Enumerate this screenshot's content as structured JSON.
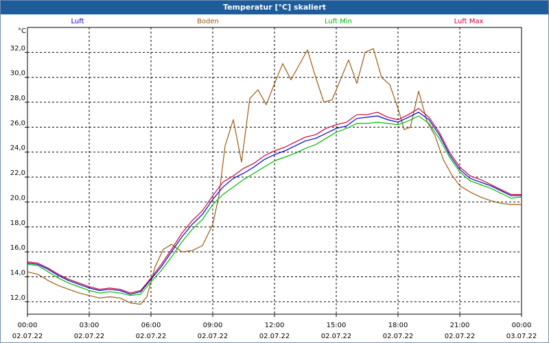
{
  "chart_data": {
    "type": "line",
    "title": "Temperatur [°C] skaliert",
    "ylabel": "°C",
    "ylim": [
      11.0,
      34.0
    ],
    "y_ticks": [
      "12,0",
      "14,0",
      "16,0",
      "18,0",
      "20,0",
      "22,0",
      "24,0",
      "26,0",
      "28,0",
      "30,0",
      "32,0"
    ],
    "x_ticks": [
      {
        "time": "00:00",
        "date": "02.07.22"
      },
      {
        "time": "03:00",
        "date": "02.07.22"
      },
      {
        "time": "06:00",
        "date": "02.07.22"
      },
      {
        "time": "09:00",
        "date": "02.07.22"
      },
      {
        "time": "12:00",
        "date": "02.07.22"
      },
      {
        "time": "15:00",
        "date": "02.07.22"
      },
      {
        "time": "18:00",
        "date": "02.07.22"
      },
      {
        "time": "21:00",
        "date": "02.07.22"
      },
      {
        "time": "00:00",
        "date": "03.07.22"
      }
    ],
    "x_unit": "hours since 02.07.22 00:00",
    "grid": true,
    "legend_position": "top",
    "series": [
      {
        "name": "Luft",
        "color": "#0000cc",
        "x": [
          0,
          0.5,
          1,
          1.5,
          2,
          2.5,
          3,
          3.5,
          4,
          4.5,
          5,
          5.5,
          6,
          6.5,
          7,
          7.5,
          8,
          8.5,
          9,
          9.5,
          10,
          10.5,
          11,
          11.5,
          12,
          12.5,
          13,
          13.5,
          14,
          14.5,
          15,
          15.5,
          16,
          16.5,
          17,
          17.5,
          18,
          18.5,
          19,
          19.5,
          20,
          20.5,
          21,
          21.5,
          22,
          22.5,
          23,
          23.5,
          24
        ],
        "y": [
          15.1,
          15.0,
          14.6,
          14.1,
          13.7,
          13.4,
          13.1,
          12.9,
          13.0,
          12.9,
          12.6,
          12.8,
          13.8,
          14.8,
          16.0,
          17.2,
          18.2,
          19.0,
          20.2,
          21.2,
          21.9,
          22.3,
          22.8,
          23.4,
          23.8,
          24.1,
          24.5,
          24.9,
          25.1,
          25.5,
          25.9,
          26.1,
          26.7,
          26.8,
          26.9,
          26.6,
          26.4,
          26.8,
          27.2,
          26.6,
          25.4,
          23.8,
          22.6,
          21.9,
          21.6,
          21.3,
          20.9,
          20.5,
          20.5
        ]
      },
      {
        "name": "Boden",
        "color": "#9c5a10",
        "x": [
          0,
          0.5,
          1,
          1.5,
          2,
          2.5,
          3,
          3.5,
          4,
          4.5,
          5,
          5.5,
          5.8,
          6.2,
          6.6,
          7,
          7.5,
          8,
          8.5,
          9,
          9.3,
          9.6,
          10,
          10.4,
          10.8,
          11.2,
          11.6,
          12,
          12.4,
          12.8,
          13.2,
          13.6,
          14,
          14.4,
          14.8,
          15.2,
          15.6,
          16,
          16.4,
          16.8,
          17.2,
          17.6,
          18,
          18.3,
          18.6,
          19,
          19.4,
          19.8,
          20.2,
          20.6,
          21,
          21.5,
          22,
          22.5,
          23,
          23.5,
          24
        ],
        "y": [
          14.4,
          14.2,
          13.7,
          13.3,
          13.0,
          12.7,
          12.5,
          12.3,
          12.4,
          12.3,
          11.9,
          11.8,
          12.4,
          14.8,
          16.2,
          16.6,
          16.0,
          16.1,
          16.5,
          18.2,
          20.5,
          24.5,
          26.6,
          23.2,
          28.3,
          29.0,
          27.8,
          29.5,
          31.1,
          29.8,
          31.0,
          32.2,
          30.0,
          28.0,
          28.2,
          29.8,
          31.4,
          29.5,
          32.0,
          32.3,
          30.0,
          29.4,
          27.5,
          25.8,
          26.0,
          28.9,
          26.5,
          25.3,
          23.4,
          22.2,
          21.3,
          20.8,
          20.4,
          20.1,
          19.9,
          19.8,
          19.8
        ]
      },
      {
        "name": "Luft Min",
        "color": "#00bb00",
        "x": [
          0,
          0.5,
          1,
          1.5,
          2,
          2.5,
          3,
          3.5,
          4,
          4.5,
          5,
          5.5,
          6,
          6.5,
          7,
          7.5,
          8,
          8.5,
          9,
          9.5,
          10,
          10.5,
          11,
          11.5,
          12,
          12.5,
          13,
          13.5,
          14,
          14.5,
          15,
          15.5,
          16,
          16.5,
          17,
          17.5,
          18,
          18.5,
          19,
          19.5,
          20,
          20.5,
          21,
          21.5,
          22,
          22.5,
          23,
          23.5,
          24
        ],
        "y": [
          15.0,
          14.9,
          14.4,
          13.9,
          13.5,
          13.2,
          12.9,
          12.7,
          12.8,
          12.7,
          12.5,
          12.6,
          13.6,
          14.5,
          15.6,
          16.8,
          17.8,
          18.6,
          19.8,
          20.6,
          21.2,
          21.8,
          22.3,
          22.8,
          23.3,
          23.6,
          23.9,
          24.3,
          24.6,
          25.1,
          25.6,
          25.9,
          26.3,
          26.3,
          26.4,
          26.3,
          26.2,
          26.5,
          26.9,
          26.3,
          25.1,
          23.6,
          22.4,
          21.7,
          21.4,
          21.1,
          20.7,
          20.3,
          20.4
        ]
      },
      {
        "name": "Luft Max",
        "color": "#cc0033",
        "x": [
          0,
          0.5,
          1,
          1.5,
          2,
          2.5,
          3,
          3.5,
          4,
          4.5,
          5,
          5.5,
          6,
          6.5,
          7,
          7.5,
          8,
          8.5,
          9,
          9.5,
          10,
          10.5,
          11,
          11.5,
          12,
          12.5,
          13,
          13.5,
          14,
          14.5,
          15,
          15.5,
          16,
          16.5,
          17,
          17.5,
          18,
          18.5,
          19,
          19.5,
          20,
          20.5,
          21,
          21.5,
          22,
          22.5,
          23,
          23.5,
          24
        ],
        "y": [
          15.2,
          15.1,
          14.7,
          14.2,
          13.8,
          13.5,
          13.2,
          13.0,
          13.1,
          13.0,
          12.7,
          12.9,
          13.9,
          15.0,
          16.2,
          17.5,
          18.5,
          19.3,
          20.5,
          21.6,
          22.1,
          22.7,
          23.1,
          23.7,
          24.1,
          24.4,
          24.8,
          25.2,
          25.4,
          25.9,
          26.2,
          26.4,
          27.0,
          27.0,
          27.2,
          26.8,
          26.6,
          27.0,
          27.5,
          26.8,
          25.6,
          24.0,
          22.8,
          22.1,
          21.8,
          21.4,
          21.0,
          20.6,
          20.6
        ]
      }
    ]
  }
}
